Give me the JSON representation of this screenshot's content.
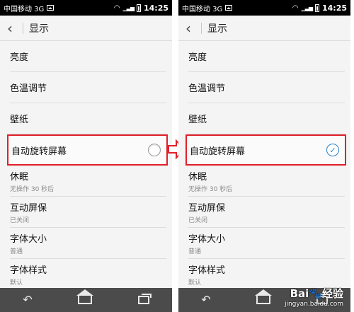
{
  "left": {
    "status": {
      "carrier": "中国移动 3G",
      "time": "14:25"
    },
    "header": {
      "title": "显示"
    },
    "items": [
      {
        "label": "亮度",
        "sub": ""
      },
      {
        "label": "色温调节",
        "sub": ""
      },
      {
        "label": "壁纸",
        "sub": ""
      },
      {
        "label": "自动旋转屏幕",
        "sub": "",
        "checked": false
      },
      {
        "label": "休眠",
        "sub": "无操作 30 秒后"
      },
      {
        "label": "互动屏保",
        "sub": "已关闭"
      },
      {
        "label": "字体大小",
        "sub": "普通"
      },
      {
        "label": "字体样式",
        "sub": "默认"
      }
    ]
  },
  "right": {
    "status": {
      "carrier": "中国移动 3G",
      "time": "14:25"
    },
    "header": {
      "title": "显示"
    },
    "items": [
      {
        "label": "亮度",
        "sub": ""
      },
      {
        "label": "色温调节",
        "sub": ""
      },
      {
        "label": "壁纸",
        "sub": ""
      },
      {
        "label": "自动旋转屏幕",
        "sub": "",
        "checked": true
      },
      {
        "label": "休眠",
        "sub": "无操作 30 秒后"
      },
      {
        "label": "互动屏保",
        "sub": "已关闭"
      },
      {
        "label": "字体大小",
        "sub": "普通"
      },
      {
        "label": "字体样式",
        "sub": "默认"
      }
    ]
  },
  "watermark": {
    "logo": "Bai🐾经验",
    "text": "jingyan.baidu.com"
  },
  "colors": {
    "highlight": "#e0202a",
    "check": "#2a7fc7",
    "navbar": "#4b4b4b"
  }
}
